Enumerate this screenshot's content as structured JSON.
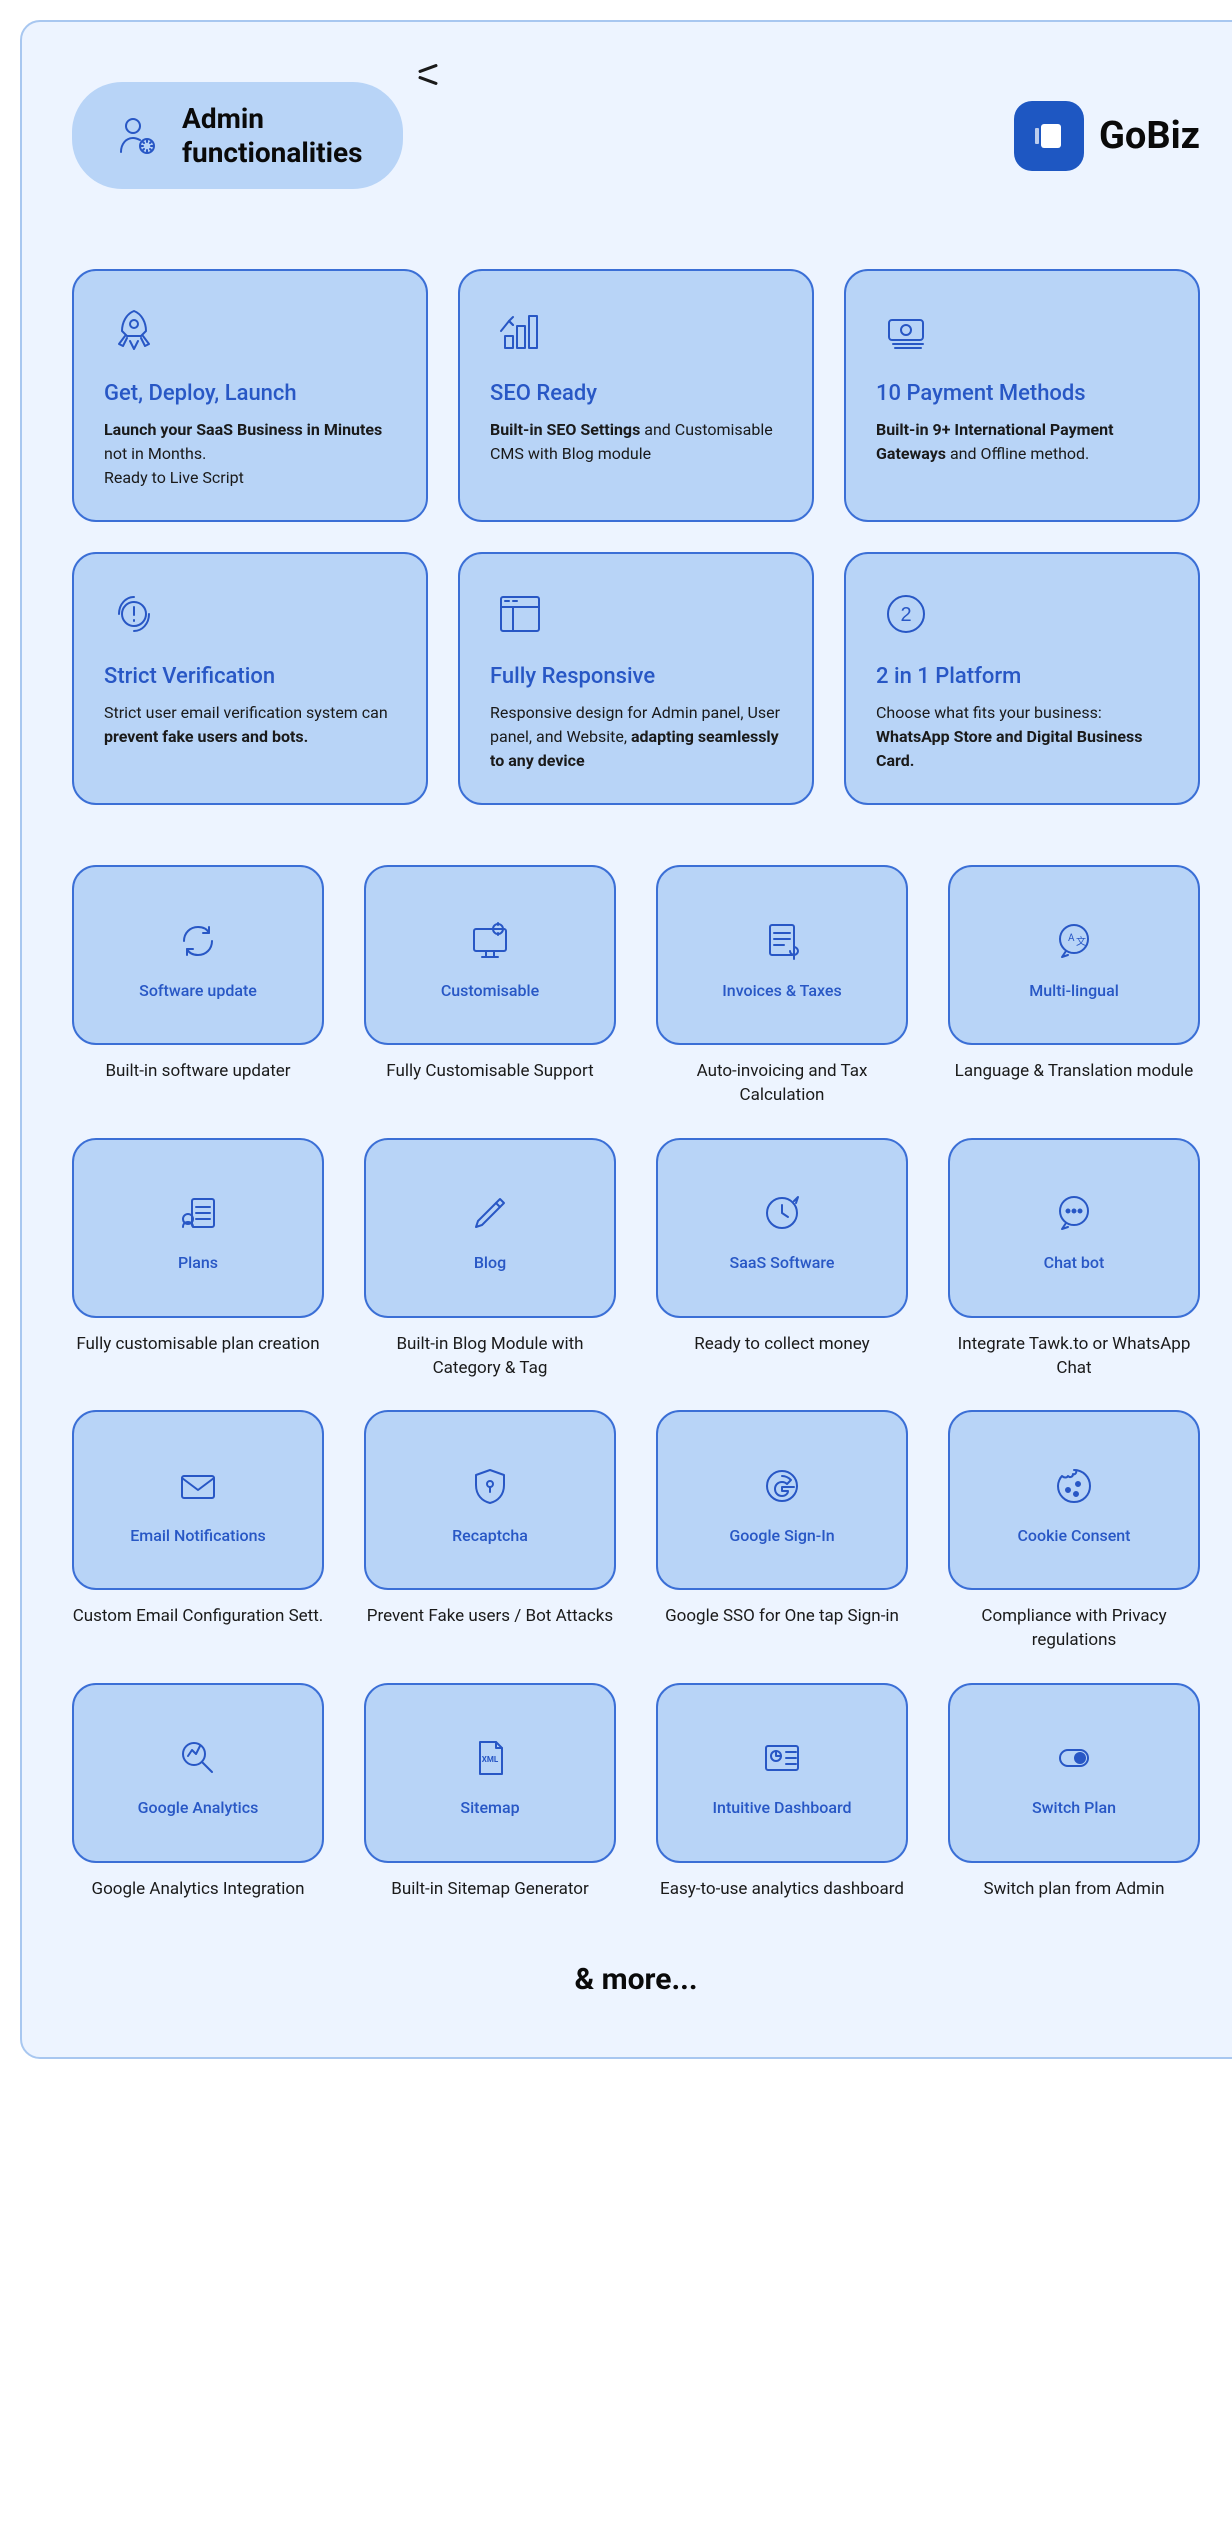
{
  "title": "Admin\nfunctionalities",
  "brand": "GoBiz",
  "big_cards": [
    {
      "title": "Get, Deploy, Launch",
      "desc": "<b>Launch your SaaS Business in Minutes</b> not in Months.<br>Ready to Live Script"
    },
    {
      "title": "SEO Ready",
      "desc": "<b>Built-in SEO Settings</b> and Customisable CMS with Blog module"
    },
    {
      "title": "10 Payment Methods",
      "desc": "<b>Built-in 9+ International Payment Gateways</b> and Offline method."
    },
    {
      "title": "Strict Verification",
      "desc": "Strict user email verification system can <b>prevent fake users and bots.</b>"
    },
    {
      "title": "Fully Responsive",
      "desc": "Responsive design for Admin panel, User panel, and Website, <b>adapting seamlessly to any device</b>"
    },
    {
      "title": "2 in 1 Platform",
      "desc": "Choose what fits your business: <b>WhatsApp Store and Digital Business Card.</b>"
    }
  ],
  "small_items": [
    {
      "title": "Software update",
      "desc": "Built-in software updater"
    },
    {
      "title": "Customisable",
      "desc": "Fully Customisable Support"
    },
    {
      "title": "Invoices & Taxes",
      "desc": "Auto-invoicing and Tax Calculation"
    },
    {
      "title": "Multi-lingual",
      "desc": "Language & Translation module"
    },
    {
      "title": "Plans",
      "desc": "Fully customisable plan creation"
    },
    {
      "title": "Blog",
      "desc": "Built-in Blog Module with Category & Tag"
    },
    {
      "title": "SaaS Software",
      "desc": "Ready to collect money"
    },
    {
      "title": "Chat bot",
      "desc": "Integrate Tawk.to or WhatsApp Chat"
    },
    {
      "title": "Email Notifications",
      "desc": "Custom Email Configuration Sett."
    },
    {
      "title": "Recaptcha",
      "desc": "Prevent Fake users / Bot Attacks"
    },
    {
      "title": "Google Sign-In",
      "desc": "Google SSO for One tap Sign-in"
    },
    {
      "title": "Cookie Consent",
      "desc": "Compliance with Privacy regulations"
    },
    {
      "title": "Google Analytics",
      "desc": "Google Analytics Integration"
    },
    {
      "title": "Sitemap",
      "desc": "Built-in Sitemap Generator"
    },
    {
      "title": "Intuitive Dashboard",
      "desc": "Easy-to-use analytics dashboard"
    },
    {
      "title": "Switch Plan",
      "desc": "Switch plan from Admin"
    }
  ],
  "footer": "& more..."
}
